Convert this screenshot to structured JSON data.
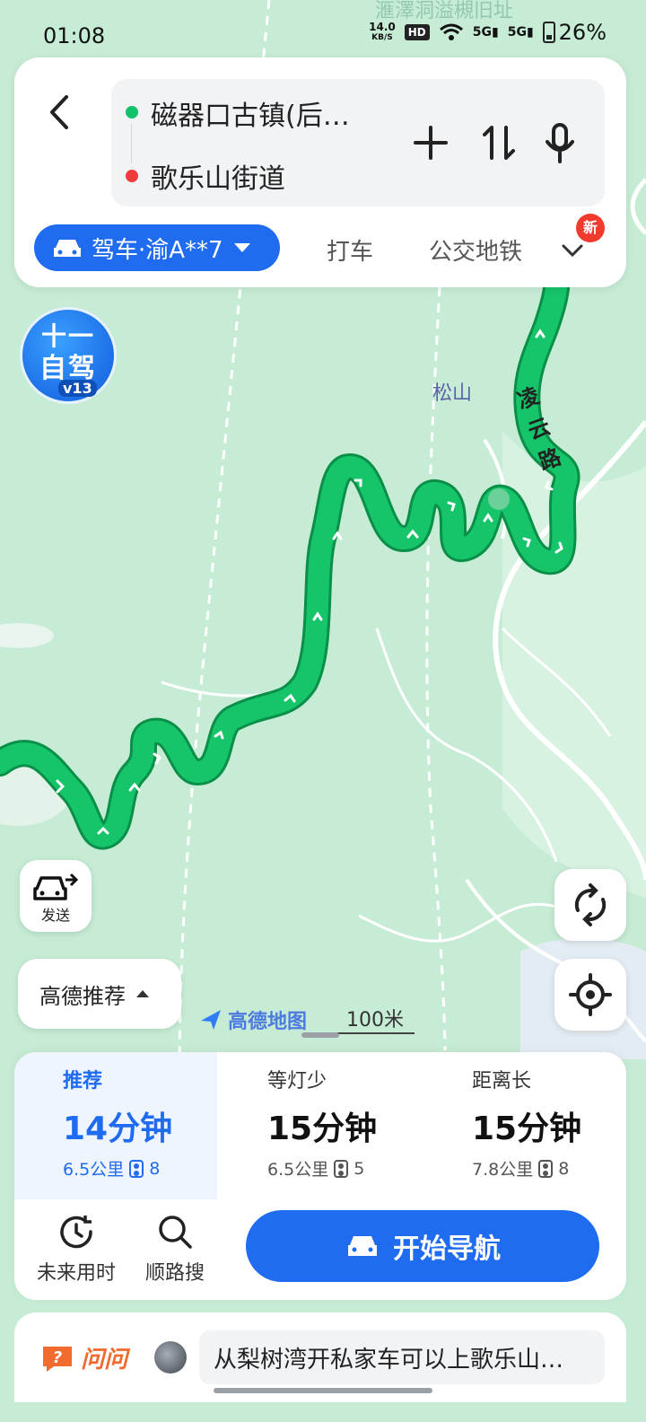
{
  "status_bar": {
    "time": "01:08",
    "net_speed_value": "14.0",
    "net_speed_unit": "KB/S",
    "hd_badge": "HD",
    "signal1": "5G",
    "signal2": "5G",
    "battery": "26%"
  },
  "route": {
    "from": "磁器口古镇(后…",
    "to": "歌乐山街道"
  },
  "modes": {
    "selected": "驾车·渝A**7",
    "taxi": "打车",
    "transit": "公交地铁",
    "new_badge": "新"
  },
  "holiday_badge": {
    "line1": "十一",
    "line2": "自驾",
    "version": "v13"
  },
  "map": {
    "poi_label": "松山",
    "road_label": [
      "凌",
      "云",
      "路"
    ],
    "top_faded_label": "滙澤洞溢槻旧址",
    "brand": "高德地图",
    "scale": "100米",
    "route_color": "#12b660"
  },
  "floating": {
    "send_label": "发送",
    "recommend_dropdown": "高德推荐"
  },
  "route_options": [
    {
      "name": "推荐",
      "duration": "14分钟",
      "distance": "6.5公里",
      "lights": "8"
    },
    {
      "name": "等灯少",
      "duration": "15分钟",
      "distance": "6.5公里",
      "lights": "5"
    },
    {
      "name": "距离长",
      "duration": "15分钟",
      "distance": "7.8公里",
      "lights": "8"
    }
  ],
  "actions": {
    "future_time": "未来用时",
    "along_search": "顺路搜",
    "start_nav": "开始导航"
  },
  "ask": {
    "brand": "问问",
    "question": "从梨树湾开私家车可以上歌乐山…"
  },
  "colors": {
    "accent": "#1f6cf0",
    "route_green": "#12b660",
    "start_dot": "#12c26a",
    "end_dot": "#ee3b3b",
    "ask_orange": "#f26b2e"
  }
}
